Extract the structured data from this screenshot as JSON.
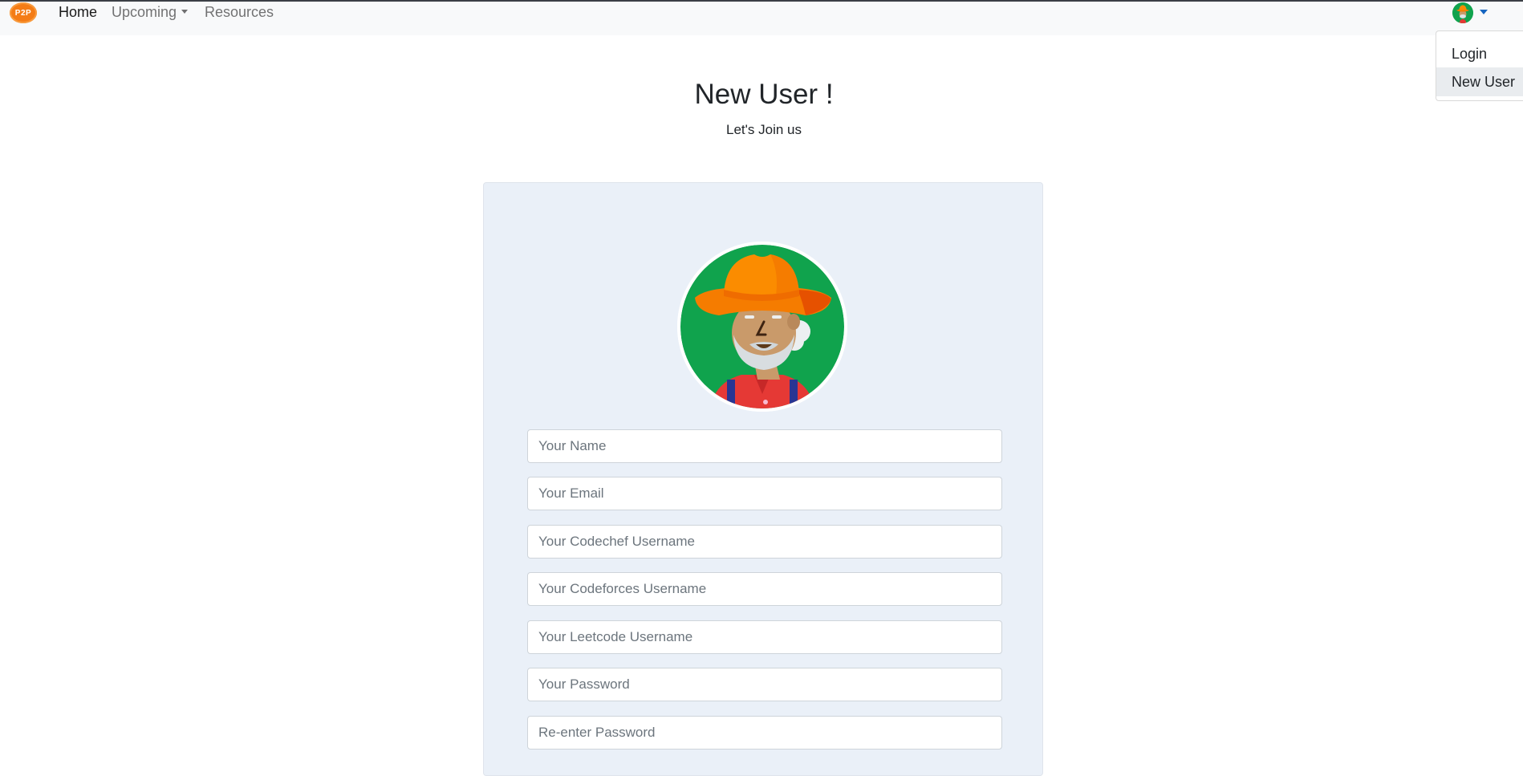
{
  "navbar": {
    "brand_text": "P2P",
    "links": [
      {
        "label": "Home",
        "active": true
      },
      {
        "label": "Upcoming",
        "has_dropdown": true
      },
      {
        "label": "Resources"
      }
    ]
  },
  "user_menu": {
    "avatar_icon": "farmer-avatar-icon",
    "items": [
      {
        "label": "Login"
      },
      {
        "label": "New User",
        "highlighted": true
      }
    ]
  },
  "page": {
    "title": "New User !",
    "subtitle": "Let's Join us"
  },
  "form": {
    "avatar_icon": "farmer-avatar-icon",
    "fields": [
      {
        "placeholder": "Your Name",
        "value": ""
      },
      {
        "placeholder": "Your Email",
        "value": ""
      },
      {
        "placeholder": "Your Codechef Username",
        "value": ""
      },
      {
        "placeholder": "Your Codeforces Username",
        "value": ""
      },
      {
        "placeholder": "Your Leetcode Username",
        "value": ""
      },
      {
        "placeholder": "Your Password",
        "value": ""
      },
      {
        "placeholder": "Re-enter Password",
        "value": ""
      }
    ]
  },
  "colors": {
    "navbar_bg": "#f8f9fa",
    "card_bg": "#eaf0f8",
    "brand_orange": "#f47c16",
    "avatar_green": "#10a34d",
    "caret_blue": "#1565c0"
  }
}
